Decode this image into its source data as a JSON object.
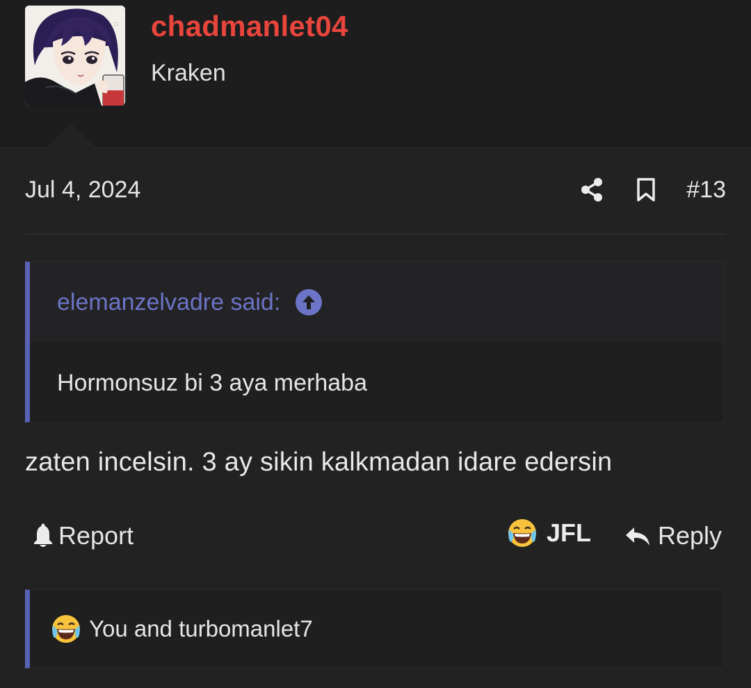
{
  "user": {
    "username": "chadmanlet04",
    "title": "Kraken",
    "avatar_icon": "anime-avatar"
  },
  "post": {
    "date": "Jul 4, 2024",
    "number": "#13",
    "body": "zaten incelsin. 3 ay sikin kalkmadan idare edersin"
  },
  "quote": {
    "author_label": "elemanzelvadre said:",
    "body": "Hormonsuz bi 3 aya merhaba"
  },
  "actions": {
    "report_label": "Report",
    "reaction_label": "JFL",
    "reply_label": "Reply"
  },
  "reactions": {
    "summary": "You and turbomanlet7"
  },
  "colors": {
    "username": "#e8453c",
    "quote_accent": "#6b74c7",
    "background": "#222223"
  }
}
